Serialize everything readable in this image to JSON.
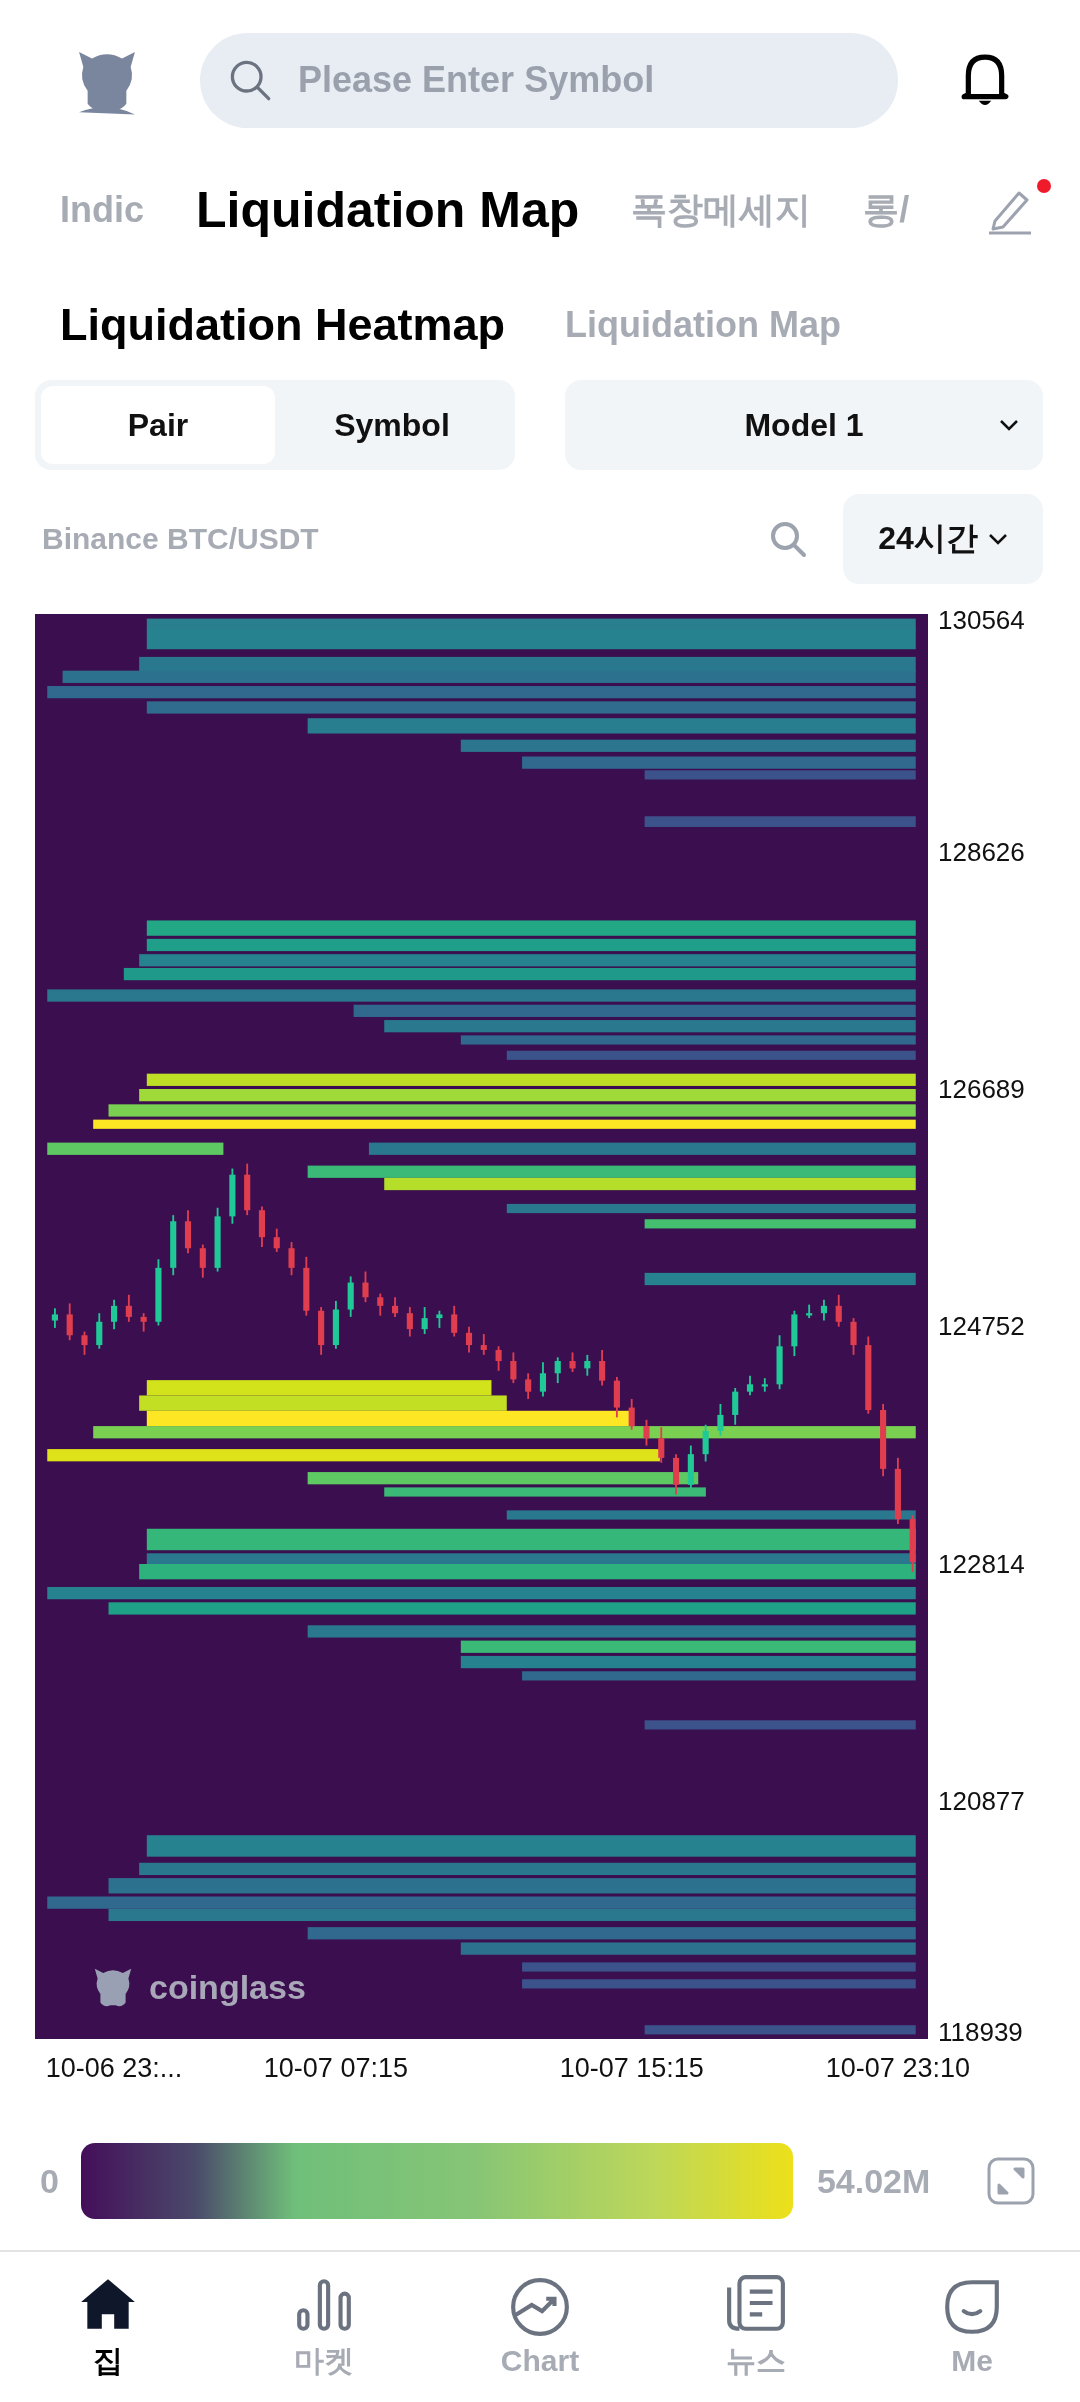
{
  "header": {
    "search": {
      "placeholder": "Please Enter Symbol"
    }
  },
  "tabs": [
    {
      "label": "Indic",
      "selected": false
    },
    {
      "label": "Liquidation Map",
      "selected": true
    },
    {
      "label": "폭창메세지",
      "selected": false
    },
    {
      "label": "롱/",
      "selected": false
    }
  ],
  "edit_badge": true,
  "sub_tabs": [
    {
      "label": "Liquidation Heatmap",
      "selected": true
    },
    {
      "label": "Liquidation Map",
      "selected": false
    }
  ],
  "segment": [
    {
      "label": "Pair",
      "selected": true
    },
    {
      "label": "Symbol",
      "selected": false
    }
  ],
  "model_dropdown": "Model 1",
  "pair_label": "Binance BTC/USDT",
  "period_dropdown": "24시간",
  "heatmap": {
    "watermark": "coinglass",
    "chart_data": {
      "type": "candlestick",
      "categories": [
        null,
        null,
        null,
        null,
        "10-06 23:...",
        null,
        null,
        null,
        null,
        null,
        null,
        null,
        null,
        null,
        null,
        null,
        null,
        null,
        null,
        "10-07 07:15",
        null,
        null,
        null,
        null,
        null,
        null,
        null,
        null,
        null,
        null,
        null,
        null,
        null,
        null,
        null,
        null,
        null,
        null,
        null,
        "10-07 15:15",
        null,
        null,
        null,
        null,
        null,
        null,
        null,
        null,
        null,
        null,
        null,
        null,
        null,
        null,
        null,
        null,
        null,
        "10-07 23:10",
        null
      ],
      "ohlc": [
        [
          124800,
          124900,
          124740,
          124850
        ],
        [
          124850,
          124940,
          124640,
          124680
        ],
        [
          124680,
          124710,
          124520,
          124600
        ],
        [
          124600,
          124860,
          124570,
          124790
        ],
        [
          124790,
          124970,
          124730,
          124920
        ],
        [
          124920,
          125010,
          124790,
          124830
        ],
        [
          124830,
          124860,
          124710,
          124790
        ],
        [
          124790,
          125300,
          124760,
          125230
        ],
        [
          125230,
          125660,
          125170,
          125610
        ],
        [
          125610,
          125700,
          125350,
          125390
        ],
        [
          125390,
          125420,
          125150,
          125230
        ],
        [
          125230,
          125720,
          125200,
          125650
        ],
        [
          125650,
          126040,
          125590,
          125990
        ],
        [
          125990,
          126080,
          125660,
          125700
        ],
        [
          125700,
          125730,
          125400,
          125480
        ],
        [
          125480,
          125550,
          125360,
          125390
        ],
        [
          125390,
          125440,
          125170,
          125230
        ],
        [
          125230,
          125320,
          124840,
          124880
        ],
        [
          124880,
          124910,
          124520,
          124600
        ],
        [
          124600,
          124960,
          124570,
          124890
        ],
        [
          124890,
          125160,
          124830,
          125110
        ],
        [
          125110,
          125200,
          124950,
          124990
        ],
        [
          124990,
          125020,
          124840,
          124920
        ],
        [
          124920,
          124990,
          124830,
          124860
        ],
        [
          124860,
          124910,
          124670,
          124730
        ],
        [
          124730,
          124910,
          124690,
          124820
        ],
        [
          124820,
          124880,
          124740,
          124850
        ],
        [
          124850,
          124920,
          124670,
          124700
        ],
        [
          124700,
          124750,
          124540,
          124600
        ],
        [
          124600,
          124690,
          124520,
          124560
        ],
        [
          124560,
          124590,
          124390,
          124470
        ],
        [
          124470,
          124540,
          124290,
          124320
        ],
        [
          124320,
          124370,
          124160,
          124220
        ],
        [
          124220,
          124460,
          124180,
          124370
        ],
        [
          124370,
          124500,
          124290,
          124470
        ],
        [
          124470,
          124540,
          124380,
          124410
        ],
        [
          124410,
          124520,
          124350,
          124470
        ],
        [
          124470,
          124560,
          124270,
          124310
        ],
        [
          124310,
          124340,
          124010,
          124090
        ],
        [
          124090,
          124160,
          123910,
          123940
        ],
        [
          123940,
          123990,
          123780,
          123840
        ],
        [
          123840,
          123930,
          123640,
          123680
        ],
        [
          123680,
          123710,
          123380,
          123460
        ],
        [
          123460,
          123780,
          123430,
          123710
        ],
        [
          123710,
          123950,
          123650,
          123900
        ],
        [
          123900,
          124120,
          123860,
          124030
        ],
        [
          124030,
          124250,
          123950,
          124220
        ],
        [
          124220,
          124350,
          124190,
          124280
        ],
        [
          124280,
          124330,
          124220,
          124280
        ],
        [
          124280,
          124680,
          124240,
          124590
        ],
        [
          124590,
          124880,
          124510,
          124850
        ],
        [
          124850,
          124930,
          124820,
          124860
        ],
        [
          124860,
          124970,
          124800,
          124920
        ],
        [
          124920,
          125010,
          124750,
          124790
        ],
        [
          124790,
          124820,
          124520,
          124600
        ],
        [
          124600,
          124670,
          124040,
          124070
        ],
        [
          124070,
          124120,
          123530,
          123590
        ],
        [
          123590,
          123680,
          123140,
          123180
        ],
        [
          123180,
          123210,
          122750,
          122830
        ]
      ],
      "ylim": [
        118939,
        130564
      ],
      "yticks": [
        130564,
        128626,
        126689,
        124752,
        122814,
        120877,
        118939
      ]
    }
  },
  "legend": {
    "min": "0",
    "max": "54.02M"
  },
  "nav": [
    {
      "kind": "home",
      "label": "집",
      "selected": true
    },
    {
      "kind": "market",
      "label": "마켓",
      "selected": false
    },
    {
      "kind": "chart",
      "label": "Chart",
      "selected": false
    },
    {
      "kind": "news",
      "label": "뉴스",
      "selected": false
    },
    {
      "kind": "me",
      "label": "Me",
      "selected": false
    }
  ]
}
